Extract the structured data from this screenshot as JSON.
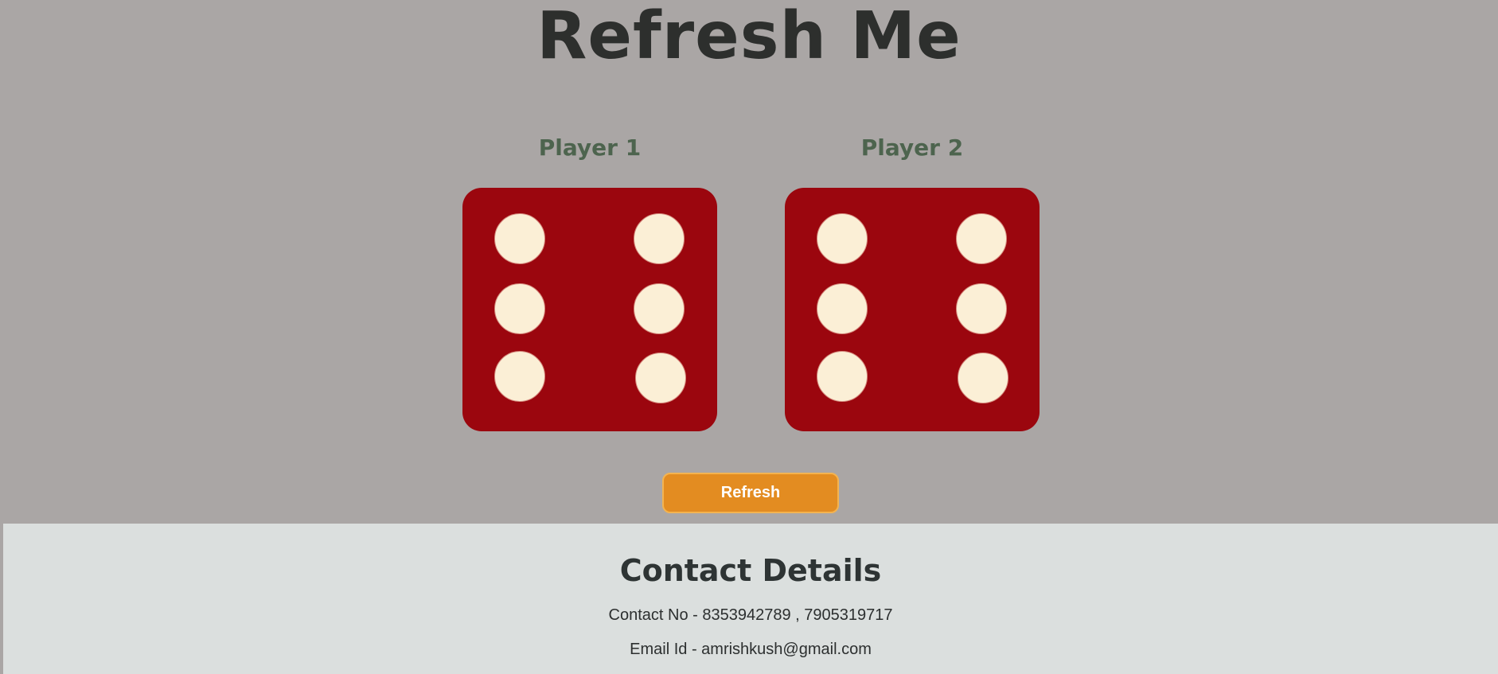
{
  "page": {
    "title": "Refresh Me"
  },
  "players": [
    {
      "name": "Player 1",
      "die_value": 6
    },
    {
      "name": "Player 2",
      "die_value": 6
    }
  ],
  "controls": {
    "refresh_label": "Refresh"
  },
  "footer": {
    "title": "Contact Details",
    "contact_line": "Contact No - 8353942789 , 7905319717",
    "email_line": "Email Id - amrishkush@gmail.com"
  },
  "colors": {
    "background": "#aaa6a5",
    "die": "#9b060e",
    "pip": "#fbefd6",
    "button": "#e38c21",
    "player_label": "#4d644e",
    "footer_background": "#dbdfde"
  }
}
